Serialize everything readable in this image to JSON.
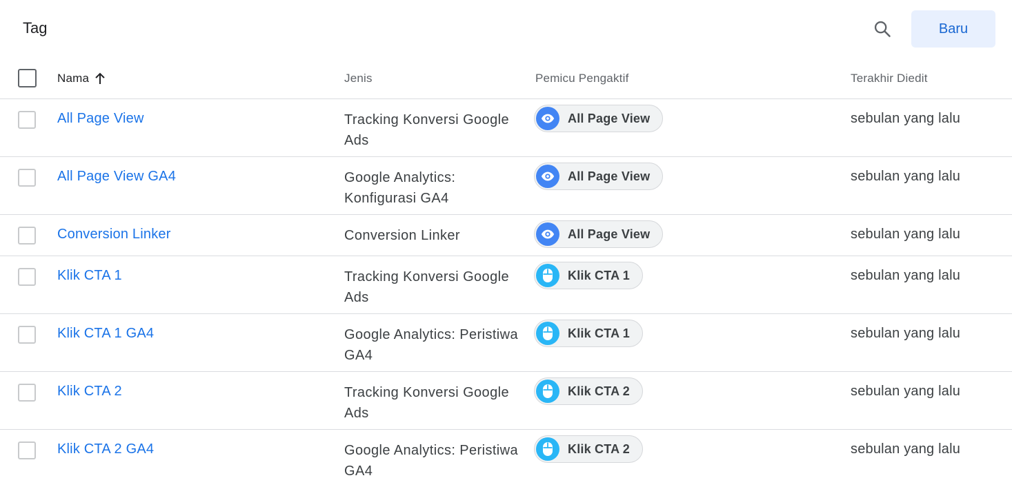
{
  "header": {
    "title": "Tag",
    "new_button_label": "Baru"
  },
  "columns": {
    "name": "Nama",
    "type": "Jenis",
    "trigger": "Pemicu Pengaktif",
    "edited": "Terakhir Diedit"
  },
  "rows": [
    {
      "name": "All Page View",
      "type": "Tracking Konversi Google Ads",
      "trigger": "All Page View",
      "trigger_icon": "eye-icon",
      "edited": "sebulan yang lalu"
    },
    {
      "name": "All Page View GA4",
      "type": "Google Analytics: Konfigurasi GA4",
      "trigger": "All Page View",
      "trigger_icon": "eye-icon",
      "edited": "sebulan yang lalu"
    },
    {
      "name": "Conversion Linker",
      "type": "Conversion Linker",
      "trigger": "All Page View",
      "trigger_icon": "eye-icon",
      "edited": "sebulan yang lalu"
    },
    {
      "name": "Klik CTA 1",
      "type": "Tracking Konversi Google Ads",
      "trigger": "Klik CTA 1",
      "trigger_icon": "mouse-icon",
      "edited": "sebulan yang lalu"
    },
    {
      "name": "Klik CTA 1 GA4",
      "type": "Google Analytics: Peristiwa GA4",
      "trigger": "Klik CTA 1",
      "trigger_icon": "mouse-icon",
      "edited": "sebulan yang lalu"
    },
    {
      "name": "Klik CTA 2",
      "type": "Tracking Konversi Google Ads",
      "trigger": "Klik CTA 2",
      "trigger_icon": "mouse-icon",
      "edited": "sebulan yang lalu"
    },
    {
      "name": "Klik CTA 2 GA4",
      "type": "Google Analytics: Peristiwa GA4",
      "trigger": "Klik CTA 2",
      "trigger_icon": "mouse-icon",
      "edited": "sebulan yang lalu"
    }
  ],
  "colors": {
    "link": "#1a73e8",
    "new_button_bg": "#e8f0fe",
    "pageview_icon": "#4285f4",
    "click_icon": "#29b6f6"
  }
}
